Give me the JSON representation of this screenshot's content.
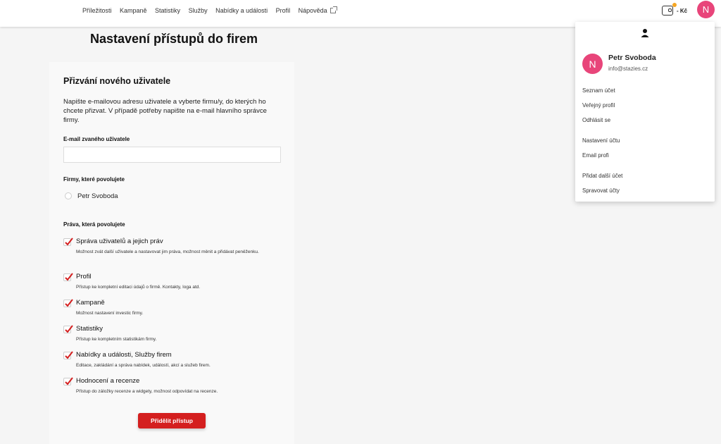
{
  "nav": {
    "items": [
      "Příležitosti",
      "Kampaně",
      "Statistiky",
      "Služby",
      "Nabídky a události",
      "Profil",
      "Nápověda"
    ]
  },
  "header": {
    "currency": "- Kč",
    "avatar_letter": "N"
  },
  "page": {
    "title": "Nastavení přístupů do firem"
  },
  "card": {
    "title": "Přizvání nového uživatele",
    "intro": "Napište e-mailovou adresu uživatele a vyberte firmu/y, do kterých ho chcete přizvat. V případě potřeby napište na e-mail hlavního správce firmy.",
    "email_label": "E-mail zvaného uživatele",
    "email_value": "",
    "companies_label": "Firmy, které povolujete",
    "company_name": "Petr Svoboda",
    "rights_label": "Práva, která povolujete",
    "permissions": [
      {
        "title": "Správa uživatelů a jejich práv",
        "desc": "Možnost zvát další uživatele a nastavovat jim práva, možnost měnit a přidávat peněženku.",
        "checked": true
      },
      {
        "title": "Profil",
        "desc": "Přístup ke kompletní editaci údajů o firmě. Kontakty, loga atd.",
        "checked": true
      },
      {
        "title": "Kampaně",
        "desc": "Možnost nastavení investic firmy.",
        "checked": true
      },
      {
        "title": "Statistiky",
        "desc": "Přístup ke kompletním statistikám firmy.",
        "checked": true
      },
      {
        "title": "Nabídky a události, Služby firem",
        "desc": "Editace, zakládání a správa nabídek, událostí, akcí a služeb firem.",
        "checked": true
      },
      {
        "title": "Hodnocení a recenze",
        "desc": "Přístup do záložky recenze a widgety, možnost odpovídat na recenze.",
        "checked": true
      }
    ],
    "submit_label": "Přidělit přístup"
  },
  "dropdown": {
    "avatar_letter": "N",
    "name": "Petr Svoboda",
    "email": "info@stazies.cz",
    "items": [
      "Seznam účet",
      "Veřejný profil",
      "Odhlásit se",
      "Nastavení účtu",
      "Email profi",
      "Přidat další účet",
      "Spravovat účty"
    ]
  },
  "colors": {
    "accent": "#d41f1f",
    "avatar": "#e8457a",
    "badge": "#f5a623"
  },
  "icons": [
    "external-link-icon",
    "wallet-icon",
    "user-icon",
    "checkmark-icon"
  ]
}
